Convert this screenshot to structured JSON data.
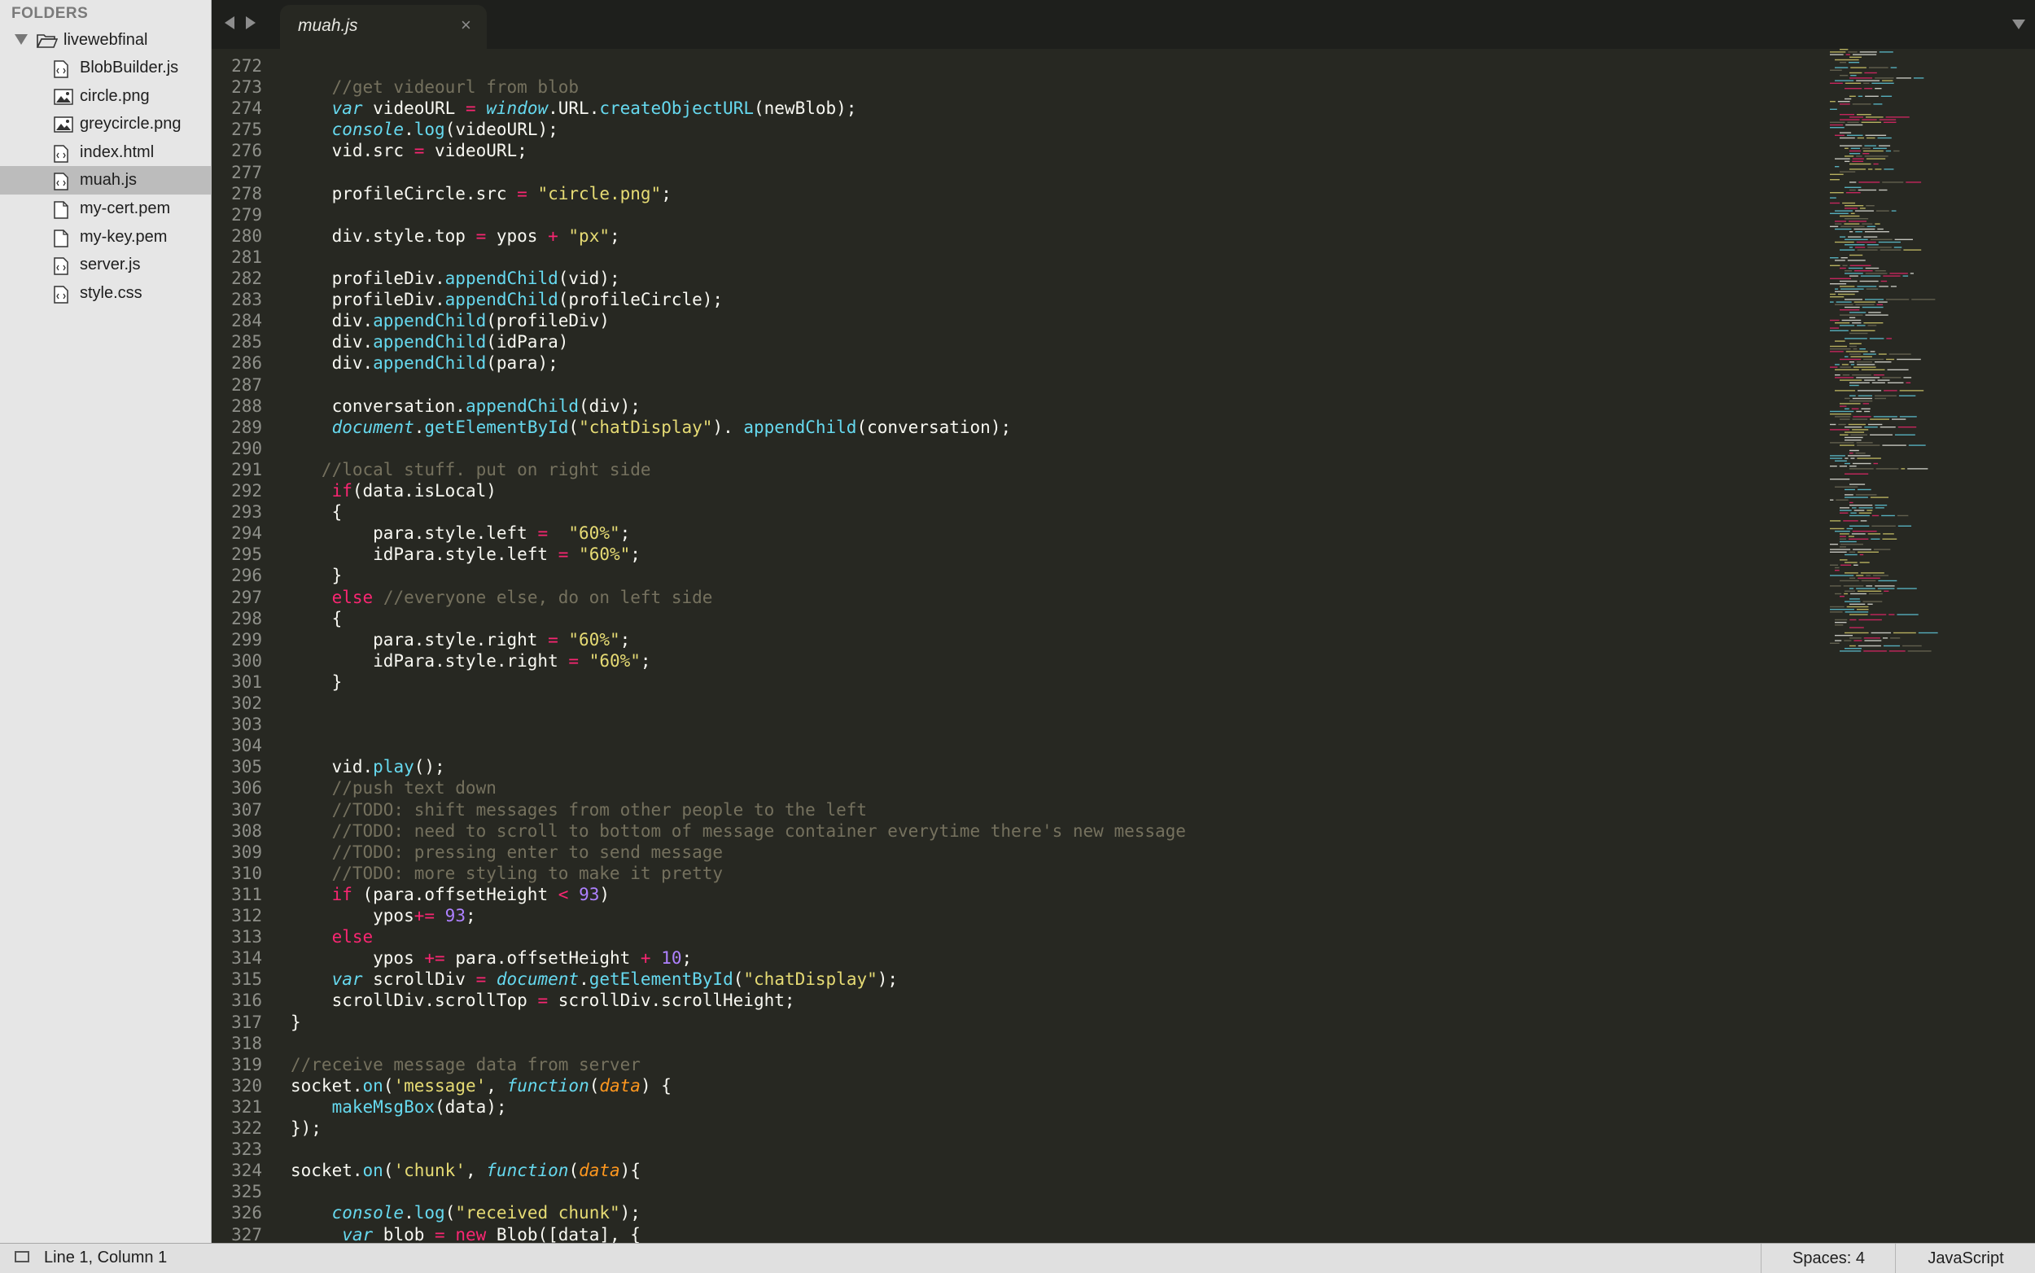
{
  "sidebar": {
    "header": "FOLDERS",
    "folder": "livewebfinal",
    "files": [
      {
        "name": "BlobBuilder.js",
        "icon": "code-file-icon"
      },
      {
        "name": "circle.png",
        "icon": "image-file-icon"
      },
      {
        "name": "greycircle.png",
        "icon": "image-file-icon"
      },
      {
        "name": "index.html",
        "icon": "code-file-icon"
      },
      {
        "name": "muah.js",
        "icon": "code-file-icon",
        "selected": true
      },
      {
        "name": "my-cert.pem",
        "icon": "file-icon"
      },
      {
        "name": "my-key.pem",
        "icon": "file-icon"
      },
      {
        "name": "server.js",
        "icon": "code-file-icon"
      },
      {
        "name": "style.css",
        "icon": "code-file-icon"
      }
    ]
  },
  "tab": {
    "label": "muah.js",
    "close": "×"
  },
  "status": {
    "position": "Line 1, Column 1",
    "spaces": "Spaces: 4",
    "syntax": "JavaScript"
  },
  "colors": {
    "background": "#272822",
    "keyword": "#f92672",
    "string": "#e6db74",
    "function": "#66d9ef",
    "comment": "#75715e",
    "number": "#ae81ff",
    "param": "#fd971f"
  },
  "lines": [
    {
      "n": "272",
      "t": [
        [
          "p_",
          ""
        ]
      ]
    },
    {
      "n": "273",
      "t": [
        [
          "c",
          "    //get videourl from blob"
        ]
      ]
    },
    {
      "n": "274",
      "t": [
        [
          "",
          "    "
        ],
        [
          "it",
          "var"
        ],
        [
          "",
          " videoURL "
        ],
        [
          "k",
          "="
        ],
        [
          "",
          " "
        ],
        [
          "it",
          "window"
        ],
        [
          "",
          ".URL."
        ],
        [
          "f",
          "createObjectURL"
        ],
        [
          "",
          "(newBlob);"
        ]
      ]
    },
    {
      "n": "275",
      "t": [
        [
          "",
          "    "
        ],
        [
          "it",
          "console"
        ],
        [
          "",
          "."
        ],
        [
          "f",
          "log"
        ],
        [
          "",
          "(videoURL);"
        ]
      ]
    },
    {
      "n": "276",
      "t": [
        [
          "",
          "    vid.src "
        ],
        [
          "k",
          "="
        ],
        [
          "",
          " videoURL;"
        ]
      ]
    },
    {
      "n": "277",
      "t": []
    },
    {
      "n": "278",
      "t": [
        [
          "",
          "    profileCircle.src "
        ],
        [
          "k",
          "="
        ],
        [
          "",
          " "
        ],
        [
          "s",
          "\"circle.png\""
        ],
        [
          "",
          ";"
        ]
      ]
    },
    {
      "n": "279",
      "t": []
    },
    {
      "n": "280",
      "t": [
        [
          "",
          "    div.style.top "
        ],
        [
          "k",
          "="
        ],
        [
          "",
          " ypos "
        ],
        [
          "k",
          "+"
        ],
        [
          "",
          " "
        ],
        [
          "s",
          "\"px\""
        ],
        [
          "",
          ";"
        ]
      ]
    },
    {
      "n": "281",
      "t": []
    },
    {
      "n": "282",
      "t": [
        [
          "",
          "    profileDiv."
        ],
        [
          "f",
          "appendChild"
        ],
        [
          "",
          "(vid);"
        ]
      ]
    },
    {
      "n": "283",
      "t": [
        [
          "",
          "    profileDiv."
        ],
        [
          "f",
          "appendChild"
        ],
        [
          "",
          "(profileCircle);"
        ]
      ]
    },
    {
      "n": "284",
      "t": [
        [
          "",
          "    div."
        ],
        [
          "f",
          "appendChild"
        ],
        [
          "",
          "(profileDiv)"
        ]
      ]
    },
    {
      "n": "285",
      "t": [
        [
          "",
          "    div."
        ],
        [
          "f",
          "appendChild"
        ],
        [
          "",
          "(idPara)"
        ]
      ]
    },
    {
      "n": "286",
      "t": [
        [
          "",
          "    div."
        ],
        [
          "f",
          "appendChild"
        ],
        [
          "",
          "(para);"
        ]
      ]
    },
    {
      "n": "287",
      "t": []
    },
    {
      "n": "288",
      "t": [
        [
          "",
          "    conversation."
        ],
        [
          "f",
          "appendChild"
        ],
        [
          "",
          "(div);"
        ]
      ]
    },
    {
      "n": "289",
      "t": [
        [
          "",
          "    "
        ],
        [
          "it",
          "document"
        ],
        [
          "",
          "."
        ],
        [
          "f",
          "getElementById"
        ],
        [
          "",
          "("
        ],
        [
          "s",
          "\"chatDisplay\""
        ],
        [
          "",
          "). "
        ],
        [
          "f",
          "appendChild"
        ],
        [
          "",
          "(conversation);"
        ]
      ]
    },
    {
      "n": "290",
      "t": []
    },
    {
      "n": "291",
      "t": [
        [
          "c",
          "   //local stuff. put on right side"
        ]
      ]
    },
    {
      "n": "292",
      "t": [
        [
          "",
          "    "
        ],
        [
          "k",
          "if"
        ],
        [
          "",
          "(data.isLocal)"
        ]
      ]
    },
    {
      "n": "293",
      "t": [
        [
          "",
          "    {"
        ]
      ]
    },
    {
      "n": "294",
      "t": [
        [
          "",
          "        para.style.left "
        ],
        [
          "k",
          "="
        ],
        [
          "",
          "  "
        ],
        [
          "s",
          "\"60%\""
        ],
        [
          "",
          ";"
        ]
      ]
    },
    {
      "n": "295",
      "t": [
        [
          "",
          "        idPara.style.left "
        ],
        [
          "k",
          "="
        ],
        [
          "",
          " "
        ],
        [
          "s",
          "\"60%\""
        ],
        [
          "",
          ";"
        ]
      ]
    },
    {
      "n": "296",
      "t": [
        [
          "",
          "    }"
        ]
      ]
    },
    {
      "n": "297",
      "t": [
        [
          "",
          "    "
        ],
        [
          "k",
          "else"
        ],
        [
          "",
          " "
        ],
        [
          "c",
          "//everyone else, do on left side"
        ]
      ]
    },
    {
      "n": "298",
      "t": [
        [
          "",
          "    {"
        ]
      ]
    },
    {
      "n": "299",
      "t": [
        [
          "",
          "        para.style.right "
        ],
        [
          "k",
          "="
        ],
        [
          "",
          " "
        ],
        [
          "s",
          "\"60%\""
        ],
        [
          "",
          ";"
        ]
      ]
    },
    {
      "n": "300",
      "t": [
        [
          "",
          "        idPara.style.right "
        ],
        [
          "k",
          "="
        ],
        [
          "",
          " "
        ],
        [
          "s",
          "\"60%\""
        ],
        [
          "",
          ";"
        ]
      ]
    },
    {
      "n": "301",
      "t": [
        [
          "",
          "    }"
        ]
      ]
    },
    {
      "n": "302",
      "t": []
    },
    {
      "n": "303",
      "t": []
    },
    {
      "n": "304",
      "t": []
    },
    {
      "n": "305",
      "t": [
        [
          "",
          "    vid."
        ],
        [
          "f",
          "play"
        ],
        [
          "",
          "();"
        ]
      ]
    },
    {
      "n": "306",
      "t": [
        [
          "c",
          "    //push text down"
        ]
      ]
    },
    {
      "n": "307",
      "t": [
        [
          "c",
          "    //TODO: shift messages from other people to the left"
        ]
      ]
    },
    {
      "n": "308",
      "t": [
        [
          "c",
          "    //TODO: need to scroll to bottom of message container everytime there's new message"
        ]
      ]
    },
    {
      "n": "309",
      "t": [
        [
          "c",
          "    //TODO: pressing enter to send message"
        ]
      ]
    },
    {
      "n": "310",
      "t": [
        [
          "c",
          "    //TODO: more styling to make it pretty"
        ]
      ]
    },
    {
      "n": "311",
      "t": [
        [
          "",
          "    "
        ],
        [
          "k",
          "if"
        ],
        [
          "",
          " (para.offsetHeight "
        ],
        [
          "k",
          "<"
        ],
        [
          "",
          " "
        ],
        [
          "n",
          "93"
        ],
        [
          "",
          ")"
        ]
      ]
    },
    {
      "n": "312",
      "t": [
        [
          "",
          "        ypos"
        ],
        [
          "k",
          "+="
        ],
        [
          "",
          " "
        ],
        [
          "n",
          "93"
        ],
        [
          "",
          ";"
        ]
      ]
    },
    {
      "n": "313",
      "t": [
        [
          "",
          "    "
        ],
        [
          "k",
          "else"
        ]
      ]
    },
    {
      "n": "314",
      "t": [
        [
          "",
          "        ypos "
        ],
        [
          "k",
          "+="
        ],
        [
          "",
          " para.offsetHeight "
        ],
        [
          "k",
          "+"
        ],
        [
          "",
          " "
        ],
        [
          "n",
          "10"
        ],
        [
          "",
          ";"
        ]
      ]
    },
    {
      "n": "315",
      "t": [
        [
          "",
          "    "
        ],
        [
          "it",
          "var"
        ],
        [
          "",
          " scrollDiv "
        ],
        [
          "k",
          "="
        ],
        [
          "",
          " "
        ],
        [
          "it",
          "document"
        ],
        [
          "",
          "."
        ],
        [
          "f",
          "getElementById"
        ],
        [
          "",
          "("
        ],
        [
          "s",
          "\"chatDisplay\""
        ],
        [
          "",
          ");"
        ]
      ]
    },
    {
      "n": "316",
      "t": [
        [
          "",
          "    scrollDiv.scrollTop "
        ],
        [
          "k",
          "="
        ],
        [
          "",
          " scrollDiv.scrollHeight;"
        ]
      ]
    },
    {
      "n": "317",
      "t": [
        [
          "",
          "}"
        ]
      ]
    },
    {
      "n": "318",
      "t": []
    },
    {
      "n": "319",
      "t": [
        [
          "c",
          "//receive message data from server"
        ]
      ]
    },
    {
      "n": "320",
      "t": [
        [
          "",
          "socket."
        ],
        [
          "f",
          "on"
        ],
        [
          "",
          "("
        ],
        [
          "s",
          "'message'"
        ],
        [
          "",
          ", "
        ],
        [
          "it",
          "function"
        ],
        [
          "",
          "("
        ],
        [
          "p",
          "data"
        ],
        [
          "",
          ") {"
        ]
      ]
    },
    {
      "n": "321",
      "t": [
        [
          "",
          "    "
        ],
        [
          "f",
          "makeMsgBox"
        ],
        [
          "",
          "(data);"
        ]
      ]
    },
    {
      "n": "322",
      "t": [
        [
          "",
          "});"
        ]
      ]
    },
    {
      "n": "323",
      "t": []
    },
    {
      "n": "324",
      "t": [
        [
          "",
          "socket."
        ],
        [
          "f",
          "on"
        ],
        [
          "",
          "("
        ],
        [
          "s",
          "'chunk'"
        ],
        [
          "",
          ", "
        ],
        [
          "it",
          "function"
        ],
        [
          "",
          "("
        ],
        [
          "p",
          "data"
        ],
        [
          "",
          "){"
        ]
      ]
    },
    {
      "n": "325",
      "t": []
    },
    {
      "n": "326",
      "t": [
        [
          "",
          "    "
        ],
        [
          "it",
          "console"
        ],
        [
          "",
          "."
        ],
        [
          "f",
          "log"
        ],
        [
          "",
          "("
        ],
        [
          "s",
          "\"received chunk\""
        ],
        [
          "",
          ");"
        ]
      ]
    },
    {
      "n": "327",
      "t": [
        [
          "",
          "     "
        ],
        [
          "it",
          "var"
        ],
        [
          "",
          " blob "
        ],
        [
          "k",
          "="
        ],
        [
          "",
          " "
        ],
        [
          "k",
          "new"
        ],
        [
          "",
          " Blob([data], {"
        ]
      ]
    }
  ]
}
